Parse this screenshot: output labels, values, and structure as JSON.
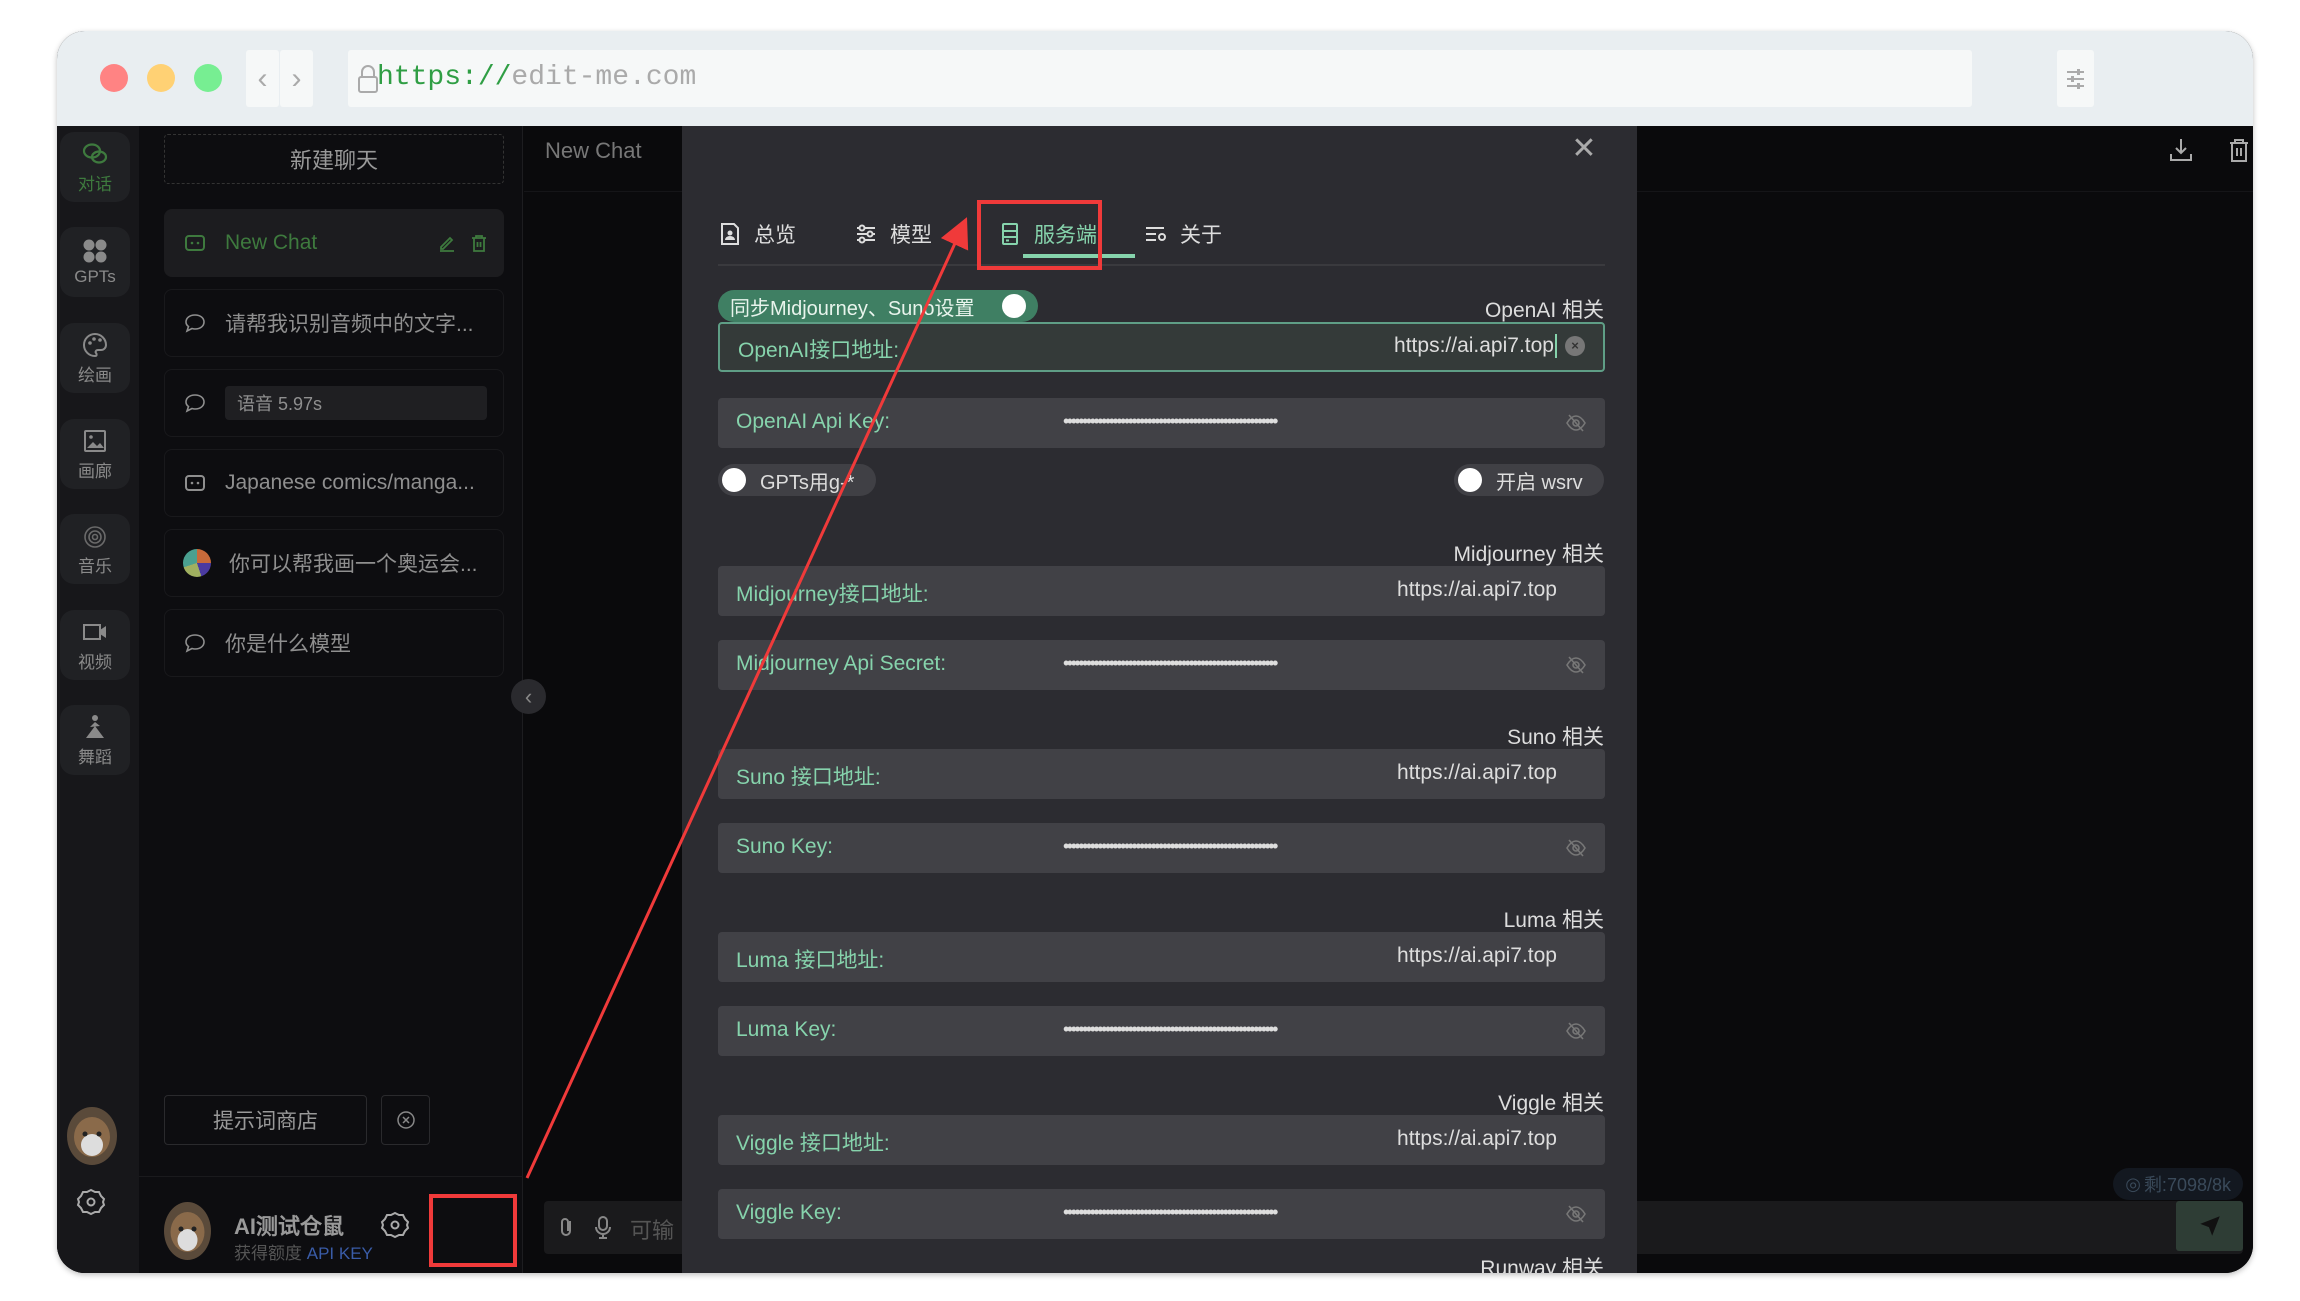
{
  "browser": {
    "url_scheme": "https://",
    "url_host": "edit-me.com",
    "back_label": "‹",
    "forward_label": "›"
  },
  "rail": {
    "items": [
      {
        "label": "对话",
        "icon": "chat-bubbles-icon",
        "active": true
      },
      {
        "label": "GPTs",
        "icon": "apps-grid-icon"
      },
      {
        "label": "绘画",
        "icon": "palette-icon"
      },
      {
        "label": "画廊",
        "icon": "image-icon"
      },
      {
        "label": "音乐",
        "icon": "music-disc-icon"
      },
      {
        "label": "视频",
        "icon": "video-camera-icon"
      },
      {
        "label": "舞蹈",
        "icon": "dance-icon"
      }
    ]
  },
  "sidebar": {
    "new_chat_button": "新建聊天",
    "chats": [
      {
        "title": "New Chat",
        "icon": "robot-chat-icon",
        "active": true
      },
      {
        "title": "请帮我识别音频中的文字...",
        "icon": "chat-bubble-icon"
      },
      {
        "title": "语音 5.97s",
        "icon": "chat-bubble-icon",
        "voice": true
      },
      {
        "title": "Japanese comics/manga...",
        "icon": "robot-chat-icon"
      },
      {
        "title": "你可以帮我画一个奥运会...",
        "icon": "image-thumbnail-icon"
      },
      {
        "title": "你是什么模型",
        "icon": "chat-bubble-icon"
      }
    ],
    "prompt_store_button": "提示词商店",
    "user": {
      "name": "AI测试仓鼠",
      "subtitle": "获得额度",
      "api_key_link": "API KEY"
    }
  },
  "main": {
    "title": "New Chat",
    "token_badge": "剩:7098/8k",
    "input_placeholder": "可输"
  },
  "settings_modal": {
    "tabs": [
      {
        "label": "总览",
        "icon": "document-user-icon"
      },
      {
        "label": "模型",
        "icon": "sliders-icon"
      },
      {
        "label": "服务端",
        "icon": "server-icon",
        "active": true
      },
      {
        "label": "关于",
        "icon": "list-settings-icon"
      }
    ],
    "sync_toggle": {
      "label": "同步Midjourney、Suno设置",
      "on": true
    },
    "gpts_toggle": {
      "label": "GPTs用g-*",
      "on": false
    },
    "wsrv_toggle": {
      "label": "开启 wsrv",
      "on": false
    },
    "sections": [
      {
        "title": "OpenAI 相关",
        "fields": [
          {
            "label": "OpenAI接口地址:",
            "value": "https://ai.api7.top",
            "type": "url",
            "focused": true
          },
          {
            "label": "OpenAI Api Key:",
            "value": "••••••••••••••••••••••••••••••••••••••••••••••••••••••••",
            "type": "secret"
          }
        ]
      },
      {
        "title": "Midjourney 相关",
        "fields": [
          {
            "label": "Midjourney接口地址:",
            "value": "https://ai.api7.top",
            "type": "url"
          },
          {
            "label": "Midjourney Api Secret:",
            "value": "••••••••••••••••••••••••••••••••••••••••••••••••••••••••",
            "type": "secret"
          }
        ]
      },
      {
        "title": "Suno 相关",
        "fields": [
          {
            "label": "Suno 接口地址:",
            "value": "https://ai.api7.top",
            "type": "url"
          },
          {
            "label": "Suno Key:",
            "value": "••••••••••••••••••••••••••••••••••••••••••••••••••••••••",
            "type": "secret"
          }
        ]
      },
      {
        "title": "Luma 相关",
        "fields": [
          {
            "label": "Luma 接口地址:",
            "value": "https://ai.api7.top",
            "type": "url"
          },
          {
            "label": "Luma Key:",
            "value": "••••••••••••••••••••••••••••••••••••••••••••••••••••••••",
            "type": "secret"
          }
        ]
      },
      {
        "title": "Viggle 相关",
        "fields": [
          {
            "label": "Viggle 接口地址:",
            "value": "https://ai.api7.top",
            "type": "url"
          },
          {
            "label": "Viggle Key:",
            "value": "••••••••••••••••••••••••••••••••••••••••••••••••••••••••",
            "type": "secret"
          }
        ]
      },
      {
        "title": "Runway 相关",
        "fields": []
      }
    ]
  },
  "annotation": {
    "color": "#f03a3a"
  }
}
